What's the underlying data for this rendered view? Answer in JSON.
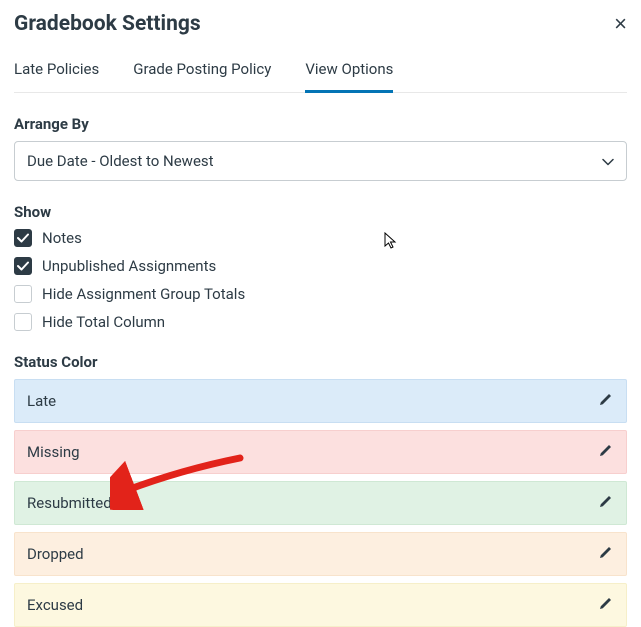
{
  "header": {
    "title": "Gradebook Settings",
    "close": "×"
  },
  "tabs": {
    "items": [
      {
        "label": "Late Policies",
        "active": false
      },
      {
        "label": "Grade Posting Policy",
        "active": false
      },
      {
        "label": "View Options",
        "active": true
      }
    ]
  },
  "arrange": {
    "label": "Arrange By",
    "value": "Due Date - Oldest to Newest"
  },
  "show": {
    "label": "Show",
    "options": [
      {
        "label": "Notes",
        "checked": true
      },
      {
        "label": "Unpublished Assignments",
        "checked": true
      },
      {
        "label": "Hide Assignment Group Totals",
        "checked": false
      },
      {
        "label": "Hide Total Column",
        "checked": false
      }
    ]
  },
  "status": {
    "label": "Status Color",
    "items": [
      {
        "label": "Late",
        "class": "status-late"
      },
      {
        "label": "Missing",
        "class": "status-missing"
      },
      {
        "label": "Resubmitted",
        "class": "status-resubmitted"
      },
      {
        "label": "Dropped",
        "class": "status-dropped"
      },
      {
        "label": "Excused",
        "class": "status-excused"
      }
    ]
  }
}
